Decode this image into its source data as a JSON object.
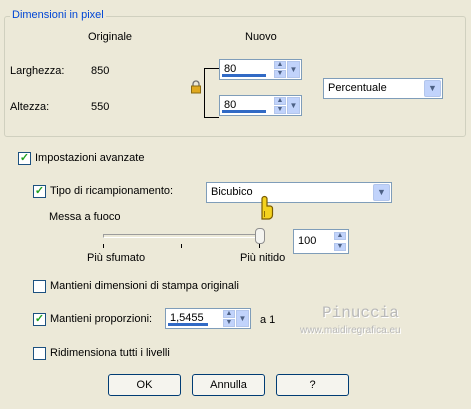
{
  "pixel_group": {
    "title": "Dimensioni in pixel",
    "col_original": "Originale",
    "col_new": "Nuovo",
    "width_label": "Larghezza:",
    "width_original": "850",
    "width_new": "80",
    "height_label": "Altezza:",
    "height_original": "550",
    "height_new": "80",
    "unit_select": "Percentuale"
  },
  "advanced_settings": {
    "label": "Impostazioni avanzate",
    "checked": true
  },
  "resample": {
    "label": "Tipo di ricampionamento:",
    "checked": true,
    "value": "Bicubico"
  },
  "sharpness": {
    "label": "Messa a fuoco",
    "min_label": "Più sfumato",
    "max_label": "Più nitido",
    "value": "100"
  },
  "keep_print": {
    "label": "Mantieni dimensioni di stampa originali",
    "checked": false
  },
  "keep_ratio": {
    "label": "Mantieni proporzioni:",
    "checked": true,
    "value": "1,5455",
    "suffix": "a 1"
  },
  "resize_all": {
    "label": "Ridimensiona tutti i livelli",
    "checked": false
  },
  "buttons": {
    "ok": "OK",
    "cancel": "Annulla",
    "help": "?"
  },
  "watermark": {
    "name": "Pinuccia",
    "url": "www.maidiregrafica.eu"
  },
  "colors": {
    "background": "#ece9d8",
    "group_title": "#0046d5",
    "checkmark": "#21a121"
  },
  "icons": {
    "lock": "lock-icon",
    "cursor": "hand-pointer-icon"
  }
}
